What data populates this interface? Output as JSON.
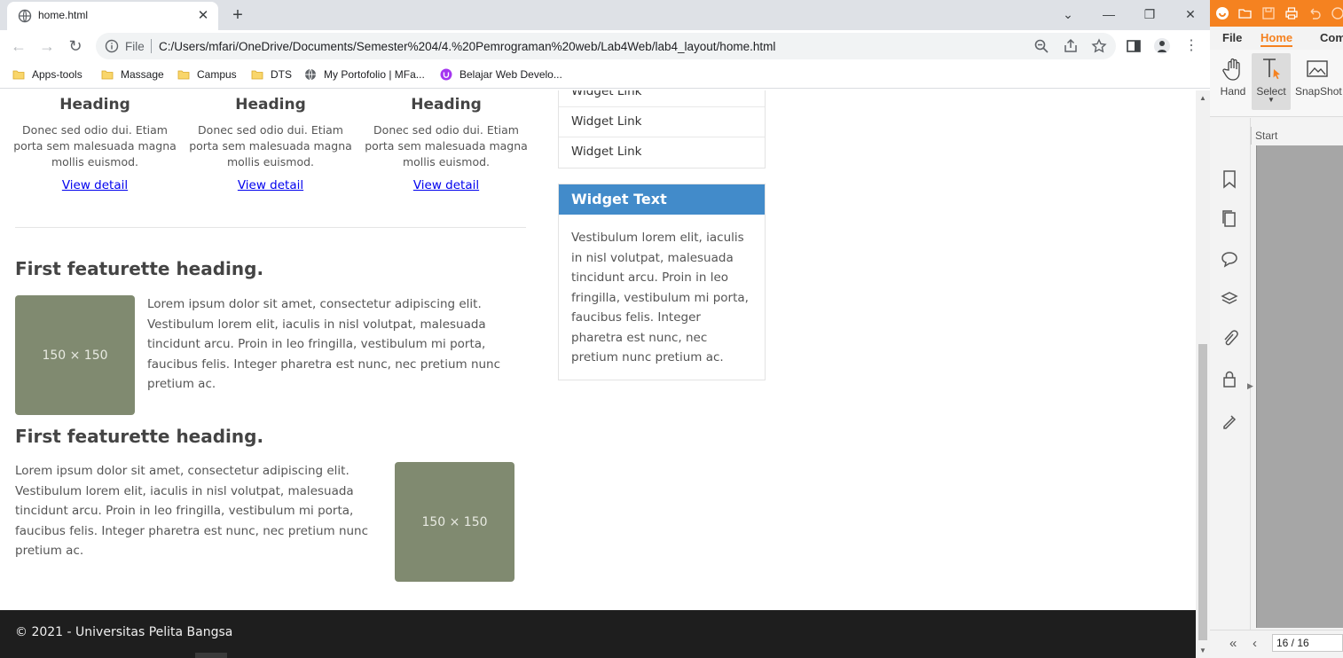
{
  "browser": {
    "tab_title": "home.html",
    "scheme_label": "File",
    "url": "C:/Users/mfari/OneDrive/Documents/Semester%204/4.%20Pemrograman%20web/Lab4Web/lab4_layout/home.html",
    "bookmarks": [
      {
        "label": "Apps-tools",
        "icon": "folder-icon"
      },
      {
        "label": "Massage",
        "icon": "folder-icon"
      },
      {
        "label": "Campus",
        "icon": "folder-icon"
      },
      {
        "label": "DTS",
        "icon": "folder-icon"
      },
      {
        "label": "My Portofolio | MFa...",
        "icon": "globe-icon"
      },
      {
        "label": "Belajar Web Develo...",
        "icon": "udemy-icon"
      }
    ]
  },
  "page": {
    "columns": [
      {
        "heading": "Heading",
        "text": "Donec sed odio dui. Etiam porta sem malesuada magna mollis euismod.",
        "link": "View detail"
      },
      {
        "heading": "Heading",
        "text": "Donec sed odio dui. Etiam porta sem malesuada magna mollis euismod.",
        "link": "View detail"
      },
      {
        "heading": "Heading",
        "text": "Donec sed odio dui. Etiam porta sem malesuada magna mollis euismod.",
        "link": "View detail"
      }
    ],
    "featurettes": [
      {
        "heading": "First featurette heading.",
        "text": "Lorem ipsum dolor sit amet, consectetur adipiscing elit. Vestibulum lorem elit, iaculis in nisl volutpat, malesuada tincidunt arcu. Proin in leo fringilla, vestibulum mi porta, faucibus felis. Integer pharetra est nunc, nec pretium nunc pretium ac.",
        "image_label": "150 × 150"
      },
      {
        "heading": "First featurette heading.",
        "text": "Lorem ipsum dolor sit amet, consectetur adipiscing elit. Vestibulum lorem elit, iaculis in nisl volutpat, malesuada tincidunt arcu. Proin in leo fringilla, vestibulum mi porta, faucibus felis. Integer pharetra est nunc, nec pretium nunc pretium ac.",
        "image_label": "150 × 150"
      }
    ],
    "sidebar": {
      "links": [
        "Widget Link",
        "Widget Link",
        "Widget Link"
      ],
      "text_widget": {
        "title": "Widget Text",
        "body": "Vestibulum lorem elit, iaculis in nisl volutpat, malesuada tincidunt arcu. Proin in leo fringilla, vestibulum mi porta, faucibus felis. Integer pharetra est nunc, nec pretium nunc pretium ac."
      }
    },
    "footer": "© 2021 - Universitas Pelita Bangsa"
  },
  "pdf_app": {
    "menu": [
      "File",
      "Home",
      "Com"
    ],
    "active_menu": "Home",
    "ribbon": [
      {
        "label": "Hand",
        "icon": "hand-icon"
      },
      {
        "label": "Select",
        "icon": "select-text-icon"
      },
      {
        "label": "SnapShot",
        "icon": "snapshot-icon"
      }
    ],
    "panel_tab": "Start",
    "page_indicator": "16 / 16"
  },
  "colors": {
    "widget_header": "#428bca",
    "placeholder": "#808a70",
    "footer": "#1e1e1e",
    "pdf_brand": "#f58220"
  }
}
